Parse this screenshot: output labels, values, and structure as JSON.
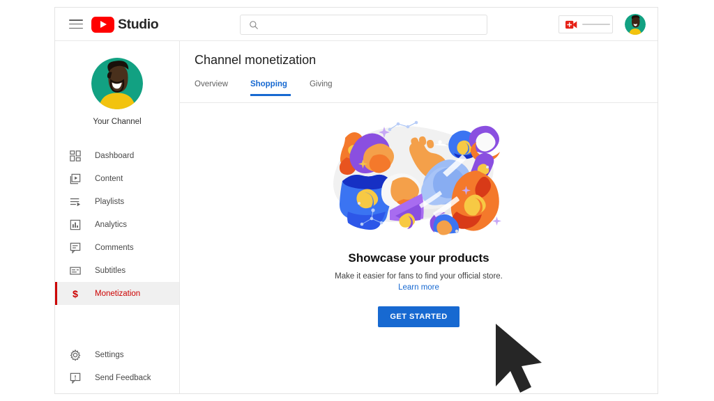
{
  "header": {
    "menu_icon": "hamburger-menu-icon",
    "brand_text": "Studio",
    "brand_logo_icon": "youtube-logo-icon",
    "search": {
      "icon": "search-icon",
      "value": "",
      "placeholder": ""
    },
    "create_button": {
      "icon": "video-camera-plus-icon",
      "label": ""
    },
    "account_avatar": "account-avatar"
  },
  "sidebar": {
    "channel": {
      "avatar": "channel-avatar",
      "name": "Your Channel"
    },
    "items": [
      {
        "label": "Dashboard",
        "icon": "dashboard-icon",
        "active": false
      },
      {
        "label": "Content",
        "icon": "content-icon",
        "active": false
      },
      {
        "label": "Playlists",
        "icon": "playlists-icon",
        "active": false
      },
      {
        "label": "Analytics",
        "icon": "analytics-icon",
        "active": false
      },
      {
        "label": "Comments",
        "icon": "comments-icon",
        "active": false
      },
      {
        "label": "Subtitles",
        "icon": "subtitles-icon",
        "active": false
      },
      {
        "label": "Monetization",
        "icon": "dollar-sign-icon",
        "active": true
      }
    ],
    "bottom_items": [
      {
        "label": "Settings",
        "icon": "gear-icon"
      },
      {
        "label": "Send Feedback",
        "icon": "feedback-icon"
      }
    ]
  },
  "main": {
    "title": "Channel monetization",
    "tabs": [
      {
        "label": "Overview",
        "active": false
      },
      {
        "label": "Shopping",
        "active": true
      },
      {
        "label": "Giving",
        "active": false
      }
    ],
    "empty_state": {
      "illustration": "merchandise-products-illustration",
      "title": "Showcase your products",
      "subtitle": "Make it easier for fans to find your official store.",
      "learn_more_label": "Learn more",
      "cta_label": "GET STARTED"
    }
  },
  "cursor": {
    "icon": "mouse-pointer-cursor"
  },
  "colors": {
    "brand_red": "#ff0000",
    "active_red": "#cc0000",
    "accent_blue": "#1769d1",
    "text_primary": "#202020",
    "text_secondary": "#606060",
    "border": "#e8e8e8",
    "active_row_bg": "#f0f0f0"
  }
}
